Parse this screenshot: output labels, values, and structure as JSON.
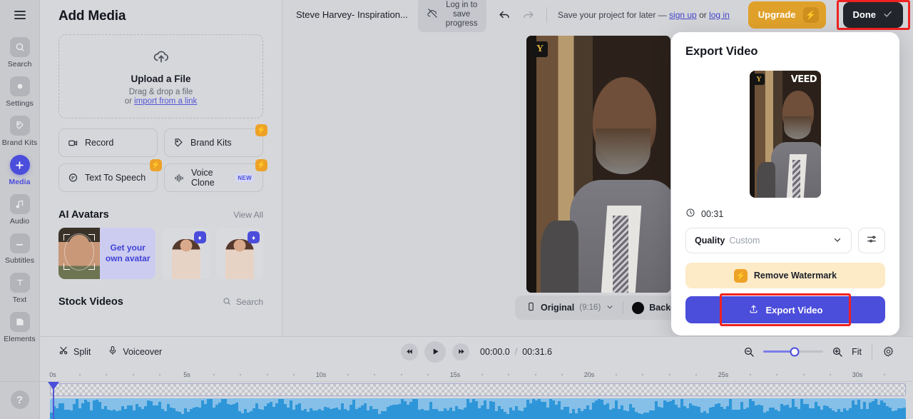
{
  "rail": {
    "menu_icon": "hamburger-icon",
    "items": [
      {
        "label": "Search",
        "icon": "search-icon"
      },
      {
        "label": "Settings",
        "icon": "settings-icon"
      },
      {
        "label": "Brand Kits",
        "icon": "brand-kits-icon"
      },
      {
        "label": "Media",
        "icon": "plus-icon",
        "active": true
      },
      {
        "label": "Audio",
        "icon": "music-note-icon"
      },
      {
        "label": "Subtitles",
        "icon": "subtitles-icon"
      },
      {
        "label": "Text",
        "icon": "text-icon"
      },
      {
        "label": "Elements",
        "icon": "elements-icon"
      }
    ],
    "help": "?"
  },
  "panel": {
    "title": "Add Media",
    "dropzone": {
      "icon": "cloud-upload-icon",
      "title": "Upload a File",
      "subtitle": "Drag & drop a file",
      "or_prefix": "or ",
      "link": "import from a link"
    },
    "tiles": [
      {
        "label": "Record",
        "icon": "record-camera-icon",
        "pro": false,
        "new": false
      },
      {
        "label": "Brand Kits",
        "icon": "brand-kits-icon",
        "pro": true,
        "new": false
      },
      {
        "label": "Text To Speech",
        "icon": "speech-bubble-icon",
        "pro": true,
        "new": false
      },
      {
        "label": "Voice Clone",
        "icon": "voice-wave-icon",
        "pro": true,
        "new": true,
        "badge": "NEW"
      }
    ],
    "ai_avatars": {
      "title": "AI Avatars",
      "action": "View All",
      "cta_line1": "Get your",
      "cta_line2": "own avatar"
    },
    "stock_videos": {
      "title": "Stock Videos",
      "search_label": "Search",
      "search_icon": "search-icon"
    }
  },
  "topbar": {
    "project_name": "Steve Harvey- Inspiration...",
    "cloud_icon": "cloud-off-icon",
    "save_pill_line1": "Log in to save",
    "save_pill_line2": "progress",
    "undo_icon": "undo-icon",
    "redo_icon": "redo-icon",
    "save_note_prefix": "Save your project for later — ",
    "sign_up": "sign up",
    "save_note_mid": " or ",
    "log_in": "log in",
    "upgrade_label": "Upgrade",
    "upgrade_icon": "bolt-icon",
    "done_label": "Done",
    "done_icon": "check-icon"
  },
  "preview": {
    "watermark_badge": "Y",
    "controls": {
      "aspect_icon": "phone-portrait-icon",
      "aspect_label": "Original",
      "aspect_ratio": "(9:16)",
      "chevron": "chevron-down-icon",
      "background_label": "Backgrou",
      "background_color": "#0b0b0d"
    }
  },
  "export": {
    "title": "Export Video",
    "thumb_badge": "Y",
    "thumb_watermark": "VEED",
    "duration_icon": "clock-icon",
    "duration": "00:31",
    "quality_label": "Quality",
    "quality_value": "Custom",
    "quality_chevron": "chevron-down-icon",
    "advanced_icon": "sliders-icon",
    "remove_watermark": "Remove Watermark",
    "remove_watermark_icon": "bolt-icon",
    "export_button": "Export Video",
    "export_icon": "upload-icon",
    "accent_color": "#4b4ddb",
    "watermark_bg": "#fdeac7",
    "highlight_color": "#ef2222"
  },
  "timeline": {
    "split_label": "Split",
    "split_icon": "scissors-icon",
    "voiceover_label": "Voiceover",
    "voiceover_icon": "microphone-icon",
    "skip_back_icon": "skip-back-icon",
    "play_icon": "play-icon",
    "skip_forward_icon": "skip-forward-icon",
    "current_time": "00:00.0",
    "time_separator": "/",
    "total_time": "00:31.6",
    "zoom_out_icon": "zoom-out-icon",
    "zoom_in_icon": "zoom-in-icon",
    "zoom_percent": 52,
    "fit_label": "Fit",
    "settings_icon": "gear-icon",
    "ruler_labels": [
      "0s",
      "5s",
      "10s",
      "15s",
      "20s",
      "25s",
      "30s"
    ],
    "playhead_time": "0s"
  }
}
